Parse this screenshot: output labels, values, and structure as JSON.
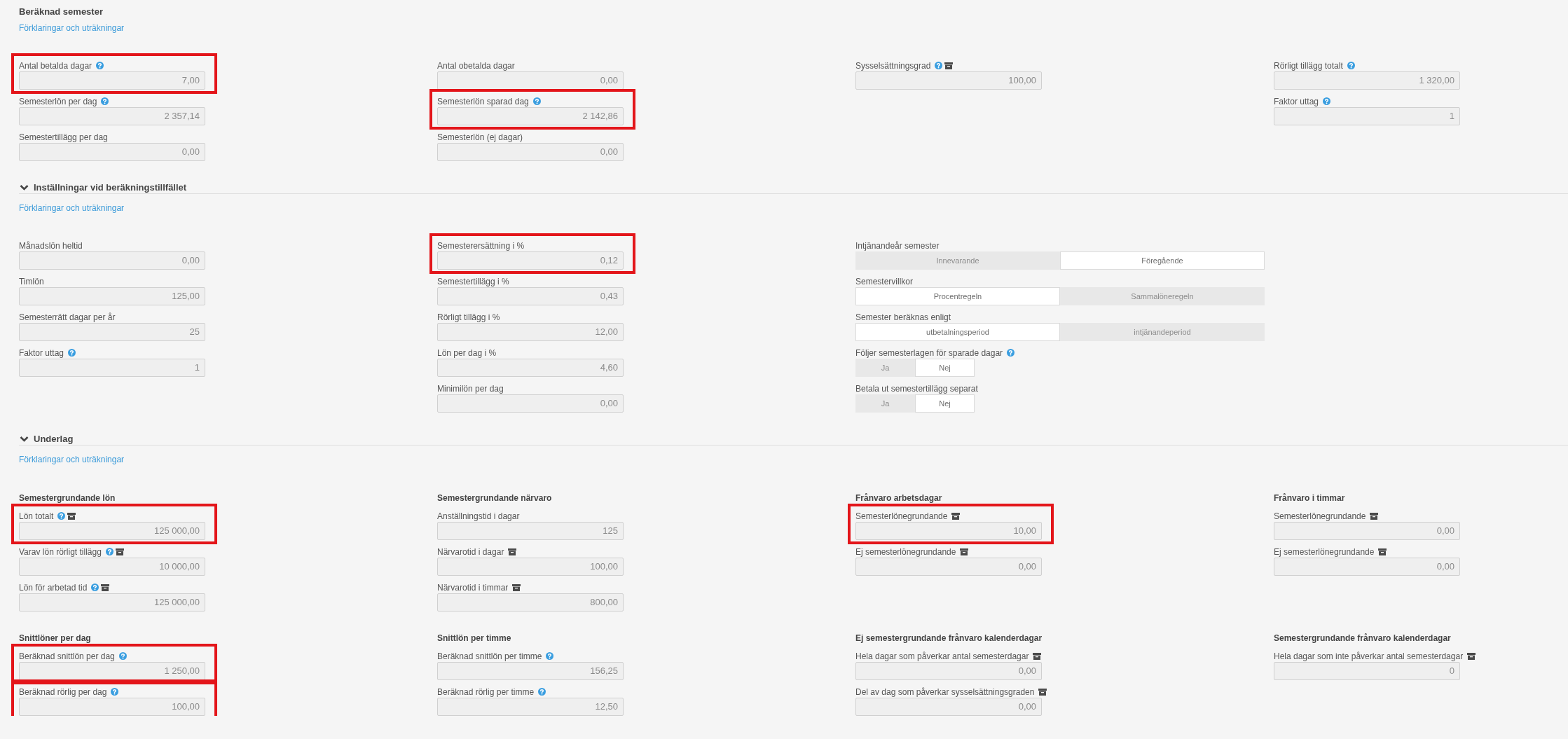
{
  "summary": {
    "title": "Beräknad semester",
    "link": "Förklaringar och uträkningar",
    "columns": [
      {
        "items": [
          {
            "kind": "number",
            "label": "Antal betalda dagar",
            "help": true,
            "archive": false,
            "value": "7,00",
            "highlighted": true
          },
          {
            "kind": "number",
            "label": "Semesterlön per dag",
            "help": true,
            "archive": false,
            "value": "2 357,14",
            "highlighted": false
          },
          {
            "kind": "number",
            "label": "Semestertillägg per dag",
            "help": false,
            "archive": false,
            "value": "0,00",
            "highlighted": false
          }
        ]
      },
      {
        "items": [
          {
            "kind": "number",
            "label": "Antal obetalda dagar",
            "help": false,
            "archive": false,
            "value": "0,00",
            "highlighted": false
          },
          {
            "kind": "number",
            "label": "Semesterlön sparad dag",
            "help": true,
            "archive": false,
            "value": "2 142,86",
            "highlighted": true
          },
          {
            "kind": "number",
            "label": "Semesterlön (ej dagar)",
            "help": false,
            "archive": false,
            "value": "0,00",
            "highlighted": false
          }
        ]
      },
      {
        "items": [
          {
            "kind": "number",
            "label": "Sysselsättningsgrad",
            "help": true,
            "archive": true,
            "value": "100,00",
            "highlighted": false
          }
        ]
      },
      {
        "items": [
          {
            "kind": "number",
            "label": "Rörligt tillägg totalt",
            "help": true,
            "archive": false,
            "value": "1 320,00",
            "highlighted": false
          },
          {
            "kind": "number",
            "label": "Faktor uttag",
            "help": true,
            "archive": false,
            "value": "1",
            "highlighted": false
          }
        ]
      }
    ]
  },
  "settings": {
    "title": "Inställningar vid beräkningstillfället",
    "expanded": true,
    "link": "Förklaringar och uträkningar",
    "columns": [
      {
        "items": [
          {
            "kind": "number",
            "label": "Månadslön heltid",
            "help": false,
            "archive": false,
            "value": "0,00",
            "highlighted": false
          },
          {
            "kind": "number",
            "label": "Timlön",
            "help": false,
            "archive": false,
            "value": "125,00",
            "highlighted": false
          },
          {
            "kind": "number",
            "label": "Semesterrätt dagar per år",
            "help": false,
            "archive": false,
            "value": "25",
            "highlighted": false
          },
          {
            "kind": "number",
            "label": "Faktor uttag",
            "help": true,
            "archive": false,
            "value": "1",
            "highlighted": false
          }
        ]
      },
      {
        "items": [
          {
            "kind": "number",
            "label": "Semesterersättning i %",
            "help": false,
            "archive": false,
            "value": "0,12",
            "highlighted": true
          },
          {
            "kind": "number",
            "label": "Semestertillägg i %",
            "help": false,
            "archive": false,
            "value": "0,43",
            "highlighted": false
          },
          {
            "kind": "number",
            "label": "Rörligt tillägg i %",
            "help": false,
            "archive": false,
            "value": "12,00",
            "highlighted": false
          },
          {
            "kind": "number",
            "label": "Lön per dag i %",
            "help": false,
            "archive": false,
            "value": "4,60",
            "highlighted": false
          },
          {
            "kind": "number",
            "label": "Minimilön per dag",
            "help": false,
            "archive": false,
            "value": "0,00",
            "highlighted": false
          }
        ]
      },
      {
        "items": [
          {
            "kind": "choice",
            "label": "Intjänandeår semester",
            "help": false,
            "archive": false,
            "options": [
              {
                "label": "Innevarande",
                "selected": false
              },
              {
                "label": "Föregående",
                "selected": true
              }
            ]
          },
          {
            "kind": "choice",
            "label": "Semestervillkor",
            "help": false,
            "archive": false,
            "options": [
              {
                "label": "Procentregeln",
                "selected": true
              },
              {
                "label": "Sammalöneregeln",
                "selected": false
              }
            ]
          },
          {
            "kind": "choice",
            "label": "Semester beräknas enligt",
            "help": false,
            "archive": false,
            "options": [
              {
                "label": "utbetalningsperiod",
                "selected": true
              },
              {
                "label": "intjänandeperiod",
                "selected": false
              }
            ]
          },
          {
            "kind": "yes_no",
            "label": "Följer semesterlagen för sparade dagar",
            "help": true,
            "archive": false,
            "options": [
              {
                "label": "Ja",
                "selected": false
              },
              {
                "label": "Nej",
                "selected": true
              }
            ]
          },
          {
            "kind": "yes_no",
            "label": "Betala ut semestertillägg separat",
            "help": false,
            "archive": false,
            "options": [
              {
                "label": "Ja",
                "selected": false
              },
              {
                "label": "Nej",
                "selected": true
              }
            ]
          }
        ]
      }
    ]
  },
  "basis": {
    "title": "Underlag",
    "expanded": true,
    "link": "Förklaringar och uträkningar",
    "groups": [
      {
        "heading": "Semestergrundande lön",
        "items": [
          {
            "kind": "number",
            "label": "Lön totalt",
            "help": true,
            "archive": true,
            "value": "125 000,00",
            "highlighted": true
          },
          {
            "kind": "number",
            "label": "Varav lön rörligt tillägg",
            "help": true,
            "archive": true,
            "value": "10 000,00",
            "highlighted": false
          },
          {
            "kind": "number",
            "label": "Lön för arbetad tid",
            "help": true,
            "archive": true,
            "value": "125 000,00",
            "highlighted": false
          }
        ]
      },
      {
        "heading": "Semestergrundande närvaro",
        "items": [
          {
            "kind": "number",
            "label": "Anställningstid i dagar",
            "help": false,
            "archive": false,
            "value": "125",
            "highlighted": false
          },
          {
            "kind": "number",
            "label": "Närvarotid i dagar",
            "help": false,
            "archive": true,
            "value": "100,00",
            "highlighted": false
          },
          {
            "kind": "number",
            "label": "Närvarotid i timmar",
            "help": false,
            "archive": true,
            "value": "800,00",
            "highlighted": false
          }
        ]
      },
      {
        "heading": "Frånvaro arbetsdagar",
        "items": [
          {
            "kind": "number",
            "label": "Semesterlönegrundande",
            "help": false,
            "archive": true,
            "value": "10,00",
            "highlighted": true
          },
          {
            "kind": "number",
            "label": "Ej semesterlönegrundande",
            "help": false,
            "archive": true,
            "value": "0,00",
            "highlighted": false
          }
        ]
      },
      {
        "heading": "Frånvaro i timmar",
        "items": [
          {
            "kind": "number",
            "label": "Semesterlönegrundande",
            "help": false,
            "archive": true,
            "value": "0,00",
            "highlighted": false
          },
          {
            "kind": "number",
            "label": "Ej semesterlönegrundande",
            "help": false,
            "archive": true,
            "value": "0,00",
            "highlighted": false
          }
        ]
      },
      {
        "heading": "Snittlöner per dag",
        "items": [
          {
            "kind": "number",
            "label": "Beräknad snittlön per dag",
            "help": true,
            "archive": false,
            "value": "1 250,00",
            "highlighted": true
          },
          {
            "kind": "number",
            "label": "Beräknad rörlig per dag",
            "help": true,
            "archive": false,
            "value": "100,00",
            "highlighted": true
          }
        ]
      },
      {
        "heading": "Snittlön per timme",
        "items": [
          {
            "kind": "number",
            "label": "Beräknad snittlön per timme",
            "help": true,
            "archive": false,
            "value": "156,25",
            "highlighted": false
          },
          {
            "kind": "number",
            "label": "Beräknad rörlig per timme",
            "help": true,
            "archive": false,
            "value": "12,50",
            "highlighted": false
          }
        ]
      },
      {
        "heading": "Ej semestergrundande frånvaro kalenderdagar",
        "items": [
          {
            "kind": "number",
            "label": "Hela dagar som påverkar antal semesterdagar",
            "help": false,
            "archive": true,
            "value": "0,00",
            "highlighted": false
          },
          {
            "kind": "number",
            "label": "Del av dag som påverkar sysselsättningsgraden",
            "help": false,
            "archive": true,
            "value": "0,00",
            "highlighted": false
          }
        ]
      },
      {
        "heading": "Semestergrundande frånvaro kalenderdagar",
        "items": [
          {
            "kind": "number",
            "label": "Hela dagar som inte påverkar antal semesterdagar",
            "help": false,
            "archive": true,
            "value": "0",
            "highlighted": false
          }
        ]
      }
    ]
  }
}
